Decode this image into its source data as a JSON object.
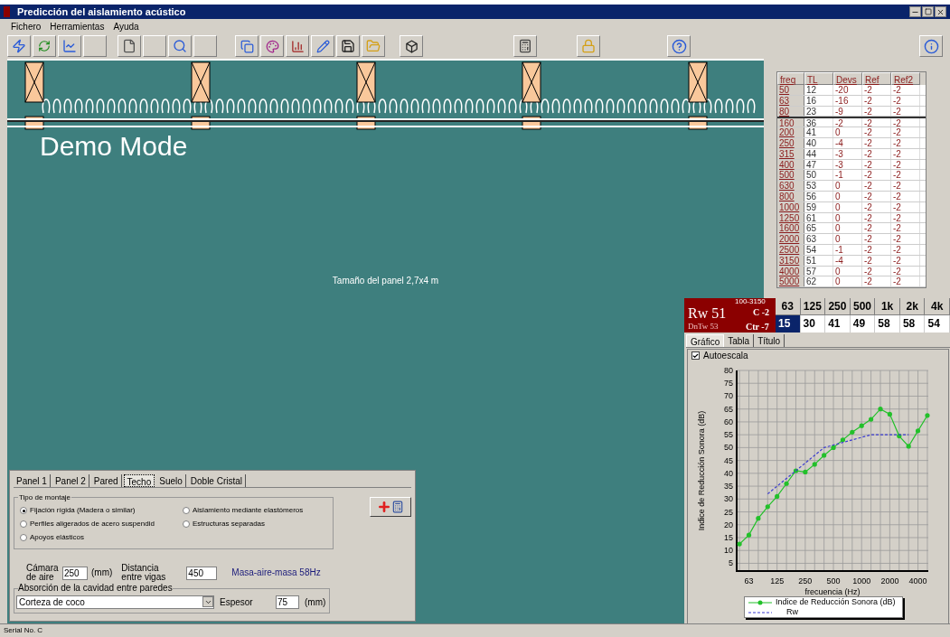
{
  "window": {
    "title": "Predicción del aislamiento acústico"
  },
  "menu": [
    "Fichero",
    "Herramientas",
    "Ayuda"
  ],
  "canvas": {
    "overlay_text": "Demo Mode",
    "panel_size": "Tamaño del panel 2,7x4 m"
  },
  "band_table": {
    "columns": [
      "freq",
      "TL",
      "Devs",
      "Ref",
      "Ref2"
    ],
    "rows": [
      [
        "50",
        "12",
        "-20",
        "-2",
        "-2"
      ],
      [
        "63",
        "16",
        "-16",
        "-2",
        "-2"
      ],
      [
        "80",
        "23",
        "-9",
        "-2",
        "-2"
      ],
      [
        "160",
        "36",
        "-2",
        "-2",
        "-2"
      ],
      [
        "200",
        "41",
        "0",
        "-2",
        "-2"
      ],
      [
        "250",
        "40",
        "-4",
        "-2",
        "-2"
      ],
      [
        "315",
        "44",
        "-3",
        "-2",
        "-2"
      ],
      [
        "400",
        "47",
        "-3",
        "-2",
        "-2"
      ],
      [
        "500",
        "50",
        "-1",
        "-2",
        "-2"
      ],
      [
        "630",
        "53",
        "0",
        "-2",
        "-2"
      ],
      [
        "800",
        "56",
        "0",
        "-2",
        "-2"
      ],
      [
        "1000",
        "59",
        "0",
        "-2",
        "-2"
      ],
      [
        "1250",
        "61",
        "0",
        "-2",
        "-2"
      ],
      [
        "1600",
        "65",
        "0",
        "-2",
        "-2"
      ],
      [
        "2000",
        "63",
        "0",
        "-2",
        "-2"
      ],
      [
        "2500",
        "54",
        "-1",
        "-2",
        "-2"
      ],
      [
        "3150",
        "51",
        "-4",
        "-2",
        "-2"
      ],
      [
        "4000",
        "57",
        "0",
        "-2",
        "-2"
      ],
      [
        "5000",
        "62",
        "0",
        "-2",
        "-2"
      ]
    ]
  },
  "ratings": {
    "rw": "Rw 51",
    "range": "100-3150",
    "c": "C -2",
    "dntw": "DnTw 53",
    "ctr": "Ctr -7"
  },
  "octave_table": {
    "headers": [
      "63",
      "125",
      "250",
      "500",
      "1k",
      "2k",
      "4k"
    ],
    "values": [
      {
        "value": "15",
        "selected": true
      },
      {
        "value": "30",
        "selected": false
      },
      {
        "value": "41",
        "selected": false
      },
      {
        "value": "49",
        "selected": false
      },
      {
        "value": "58",
        "selected": false
      },
      {
        "value": "58",
        "selected": false
      },
      {
        "value": "54",
        "selected": false
      }
    ]
  },
  "chart_panel": {
    "tabs": [
      {
        "label": "Gráfico",
        "selected": true
      },
      {
        "label": "Tabla",
        "selected": false
      },
      {
        "label": "Título",
        "selected": false
      }
    ],
    "autoscale": {
      "label": "Autoescala",
      "checked": true
    },
    "chart_data": {
      "type": "line",
      "xlabel": "frecuencia (Hz)",
      "ylabel": "Indice de Reducción Sonora (dB)",
      "categories": [
        null,
        "63",
        null,
        null,
        "125",
        null,
        null,
        "250",
        null,
        null,
        "500",
        null,
        null,
        "1000",
        null,
        null,
        "2000",
        null,
        null,
        "4000",
        null
      ],
      "grid": true,
      "legend": "bottom",
      "series": [
        {
          "name": "Indice de Reducción Sonora (dB)",
          "color": "#22c02a",
          "line_style": "solid",
          "values": [
            12.5,
            16,
            22.5,
            27,
            31,
            36,
            41,
            40.5,
            43.5,
            47,
            50,
            53,
            56,
            58.5,
            61,
            65,
            63,
            54.5,
            50.5,
            56.5,
            62.5
          ]
        },
        {
          "name": "Rw",
          "color": "#3b3bd0",
          "line_style": "dashed",
          "values": [
            null,
            null,
            null,
            32,
            35,
            38,
            41,
            44,
            47,
            50,
            51,
            52,
            53,
            54,
            55,
            55,
            55,
            55,
            55,
            null,
            null
          ]
        }
      ],
      "ylim": [
        2,
        80
      ],
      "yticks": [
        5,
        10,
        15,
        20,
        25,
        30,
        35,
        40,
        45,
        50,
        55,
        60,
        65,
        70,
        75,
        80
      ]
    }
  },
  "settings": {
    "tabs": [
      {
        "label": "Panel 1",
        "selected": false
      },
      {
        "label": "Panel 2",
        "selected": false
      },
      {
        "label": "Pared",
        "selected": false
      },
      {
        "label": "Techo",
        "selected": true
      },
      {
        "label": "Suelo",
        "selected": false
      },
      {
        "label": "Doble Cristal",
        "selected": false
      }
    ],
    "mounting": {
      "title": "Tipo de montaje",
      "options": [
        {
          "label": "Fijación rígida (Madera o similar)",
          "selected": true
        },
        {
          "label": "Aislamiento mediante elastómeros",
          "selected": false
        },
        {
          "label": "Perfiles aligerados de acero suspendid",
          "selected": false
        },
        {
          "label": "Estructuras separadas",
          "selected": false
        },
        {
          "label": "Apoyos elásticos",
          "selected": false
        }
      ]
    },
    "air_gap": {
      "label_1": "Cámara",
      "label_2": "de aire",
      "value": "250",
      "unit": "(mm)"
    },
    "joist_spacing": {
      "label_1": "Distancia",
      "label_2": "entre vigas",
      "value": "450"
    },
    "resonance": "Masa-aire-masa 58Hz",
    "absorption": {
      "title": "Absorción de la cavidad entre paredes",
      "material": "Corteza de coco",
      "thickness_label": "Espesor",
      "thickness": "75",
      "unit": "(mm)"
    }
  },
  "status_bar": "Serial No. C"
}
